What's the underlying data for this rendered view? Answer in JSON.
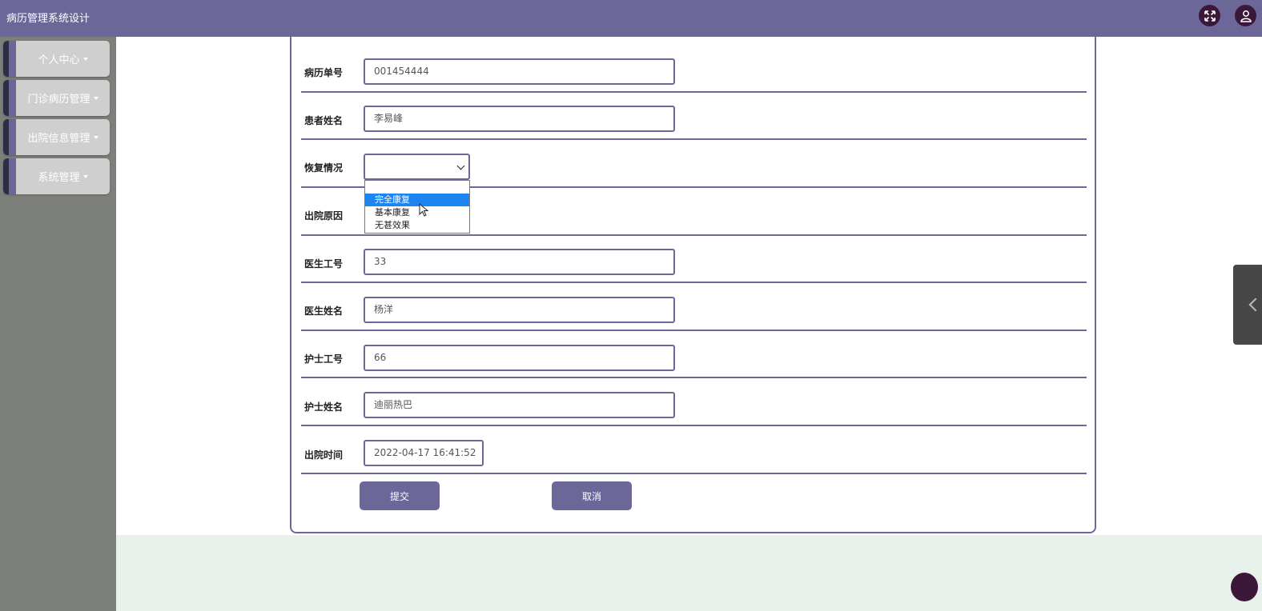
{
  "header": {
    "app_title": "病历管理系统设计",
    "icons": [
      "fullscreen-icon",
      "user-icon"
    ]
  },
  "sidebar": {
    "items": [
      {
        "label": "个人中心"
      },
      {
        "label": "门诊病历管理"
      },
      {
        "label": "出院信息管理"
      },
      {
        "label": "系统管理"
      }
    ]
  },
  "form": {
    "record_no": {
      "label": "病历单号",
      "value": "001454444"
    },
    "patient_name": {
      "label": "患者姓名",
      "value": "李易峰"
    },
    "recovery": {
      "label": "恢复情况",
      "value": "",
      "options": [
        "",
        "完全康复",
        "基本康复",
        "无甚效果"
      ],
      "highlighted": "完全康复"
    },
    "discharge_reason": {
      "label": "出院原因"
    },
    "doctor_id": {
      "label": "医生工号",
      "value": "33"
    },
    "doctor_name": {
      "label": "医生姓名",
      "value": "杨洋"
    },
    "nurse_id": {
      "label": "护士工号",
      "value": "66"
    },
    "nurse_name": {
      "label": "护士姓名",
      "value": "迪丽热巴"
    },
    "discharge_time": {
      "label": "出院时间",
      "value": "2022-04-17 16:41:52"
    },
    "submit_label": "提交",
    "cancel_label": "取消"
  },
  "colors": {
    "brand": "#6b6899",
    "sidebar_bg": "#7d7f7b",
    "highlight": "#1e84f0"
  }
}
